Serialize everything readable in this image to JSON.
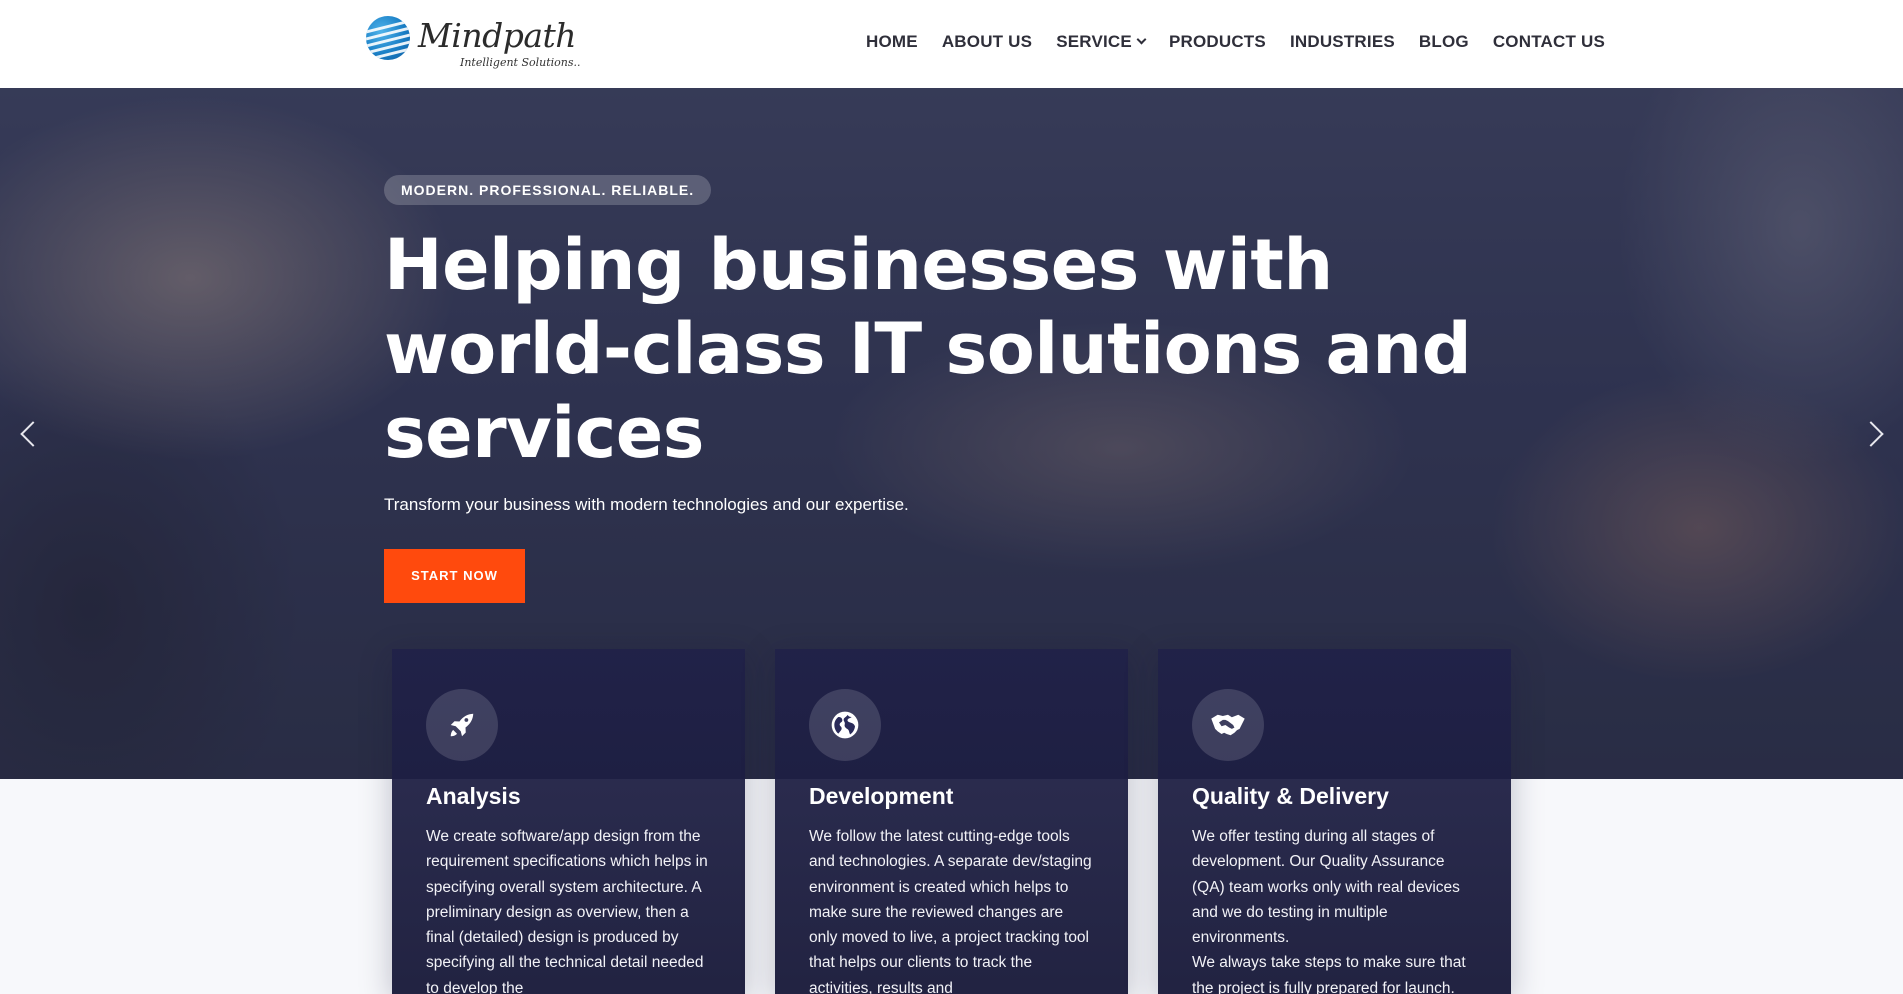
{
  "brand": {
    "name": "Mindpath",
    "tagline": "Intelligent Solutions..",
    "colors": {
      "accent": "#ff4a0d",
      "logo_blue": "#1a7fc6",
      "card_bg": "#1e1f48"
    }
  },
  "nav": {
    "items": [
      {
        "label": "HOME"
      },
      {
        "label": "ABOUT US"
      },
      {
        "label": "SERVICE",
        "has_dropdown": true
      },
      {
        "label": "PRODUCTS"
      },
      {
        "label": "INDUSTRIES"
      },
      {
        "label": "BLOG"
      },
      {
        "label": "CONTACT US"
      }
    ]
  },
  "hero": {
    "badge": "MODERN. PROFESSIONAL. RELIABLE.",
    "title": "Helping businesses with world-class IT solutions and services",
    "subtitle": "Transform your business with modern technologies and our expertise.",
    "cta_label": "START NOW",
    "prev_icon": "chevron-left-icon",
    "next_icon": "chevron-right-icon"
  },
  "features": [
    {
      "icon": "rocket-icon",
      "title": "Analysis",
      "paragraphs": [
        "We create software/app design from the requirement specifications which helps in specifying overall system architecture. A preliminary design as overview, then a final (detailed) design is produced by specifying all the technical detail needed to develop the"
      ]
    },
    {
      "icon": "globe-icon",
      "title": "Development",
      "paragraphs": [
        "We follow the latest cutting-edge tools and technologies. A separate dev/staging environment is created which helps to make sure the reviewed changes are only moved to live, a project tracking tool that helps our clients to track the activities, results and"
      ]
    },
    {
      "icon": "handshake-icon",
      "title": "Quality & Delivery",
      "paragraphs": [
        "We offer testing during all stages of development. Our Quality Assurance (QA) team works only with real devices and we do testing in multiple environments.",
        "We always take steps to make sure that the project is fully prepared for launch."
      ]
    }
  ]
}
